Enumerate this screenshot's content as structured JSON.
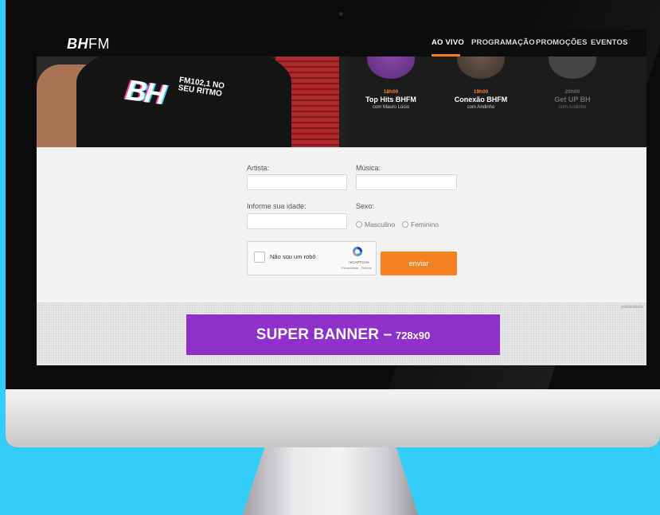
{
  "navbar": {
    "logo_bh": "BH",
    "logo_fm": "FM",
    "items": [
      "AO VIVO",
      "PROGRAMAÇÃO",
      "PROMOÇÕES",
      "EVENTOS"
    ],
    "active_index": 0,
    "accent_color": "#f48120"
  },
  "hero": {
    "shirt_logo": "BH",
    "shirt_slogan": "FM102,1 NO SEU RITMO",
    "schedule": [
      {
        "time": "18h00",
        "title": "Top Hits BHFM",
        "host": "com Mauro Lúcio"
      },
      {
        "time": "19h00",
        "title": "Conexão BHFM",
        "host": "com Andinho"
      },
      {
        "time": "20h00",
        "title": "Get UP BH",
        "host": "com Andinho"
      }
    ]
  },
  "form": {
    "artist_label": "Artista:",
    "song_label": "Música:",
    "age_label": "Informe sua idade:",
    "sex_label": "Sexo:",
    "sex_options": [
      "Masculino",
      "Feminino"
    ],
    "artist_value": "",
    "song_value": "",
    "age_value": "",
    "captcha_label": "Não sou um robô",
    "captcha_brand": "reCAPTCHA",
    "captcha_links": "Privacidade - Termos",
    "submit_label": "enviar"
  },
  "ad": {
    "tag": "publicidade",
    "banner_main": "SUPER BANNER –",
    "banner_size": "728x90",
    "banner_color": "#8e30c9"
  },
  "background_color": "#33cdfa"
}
